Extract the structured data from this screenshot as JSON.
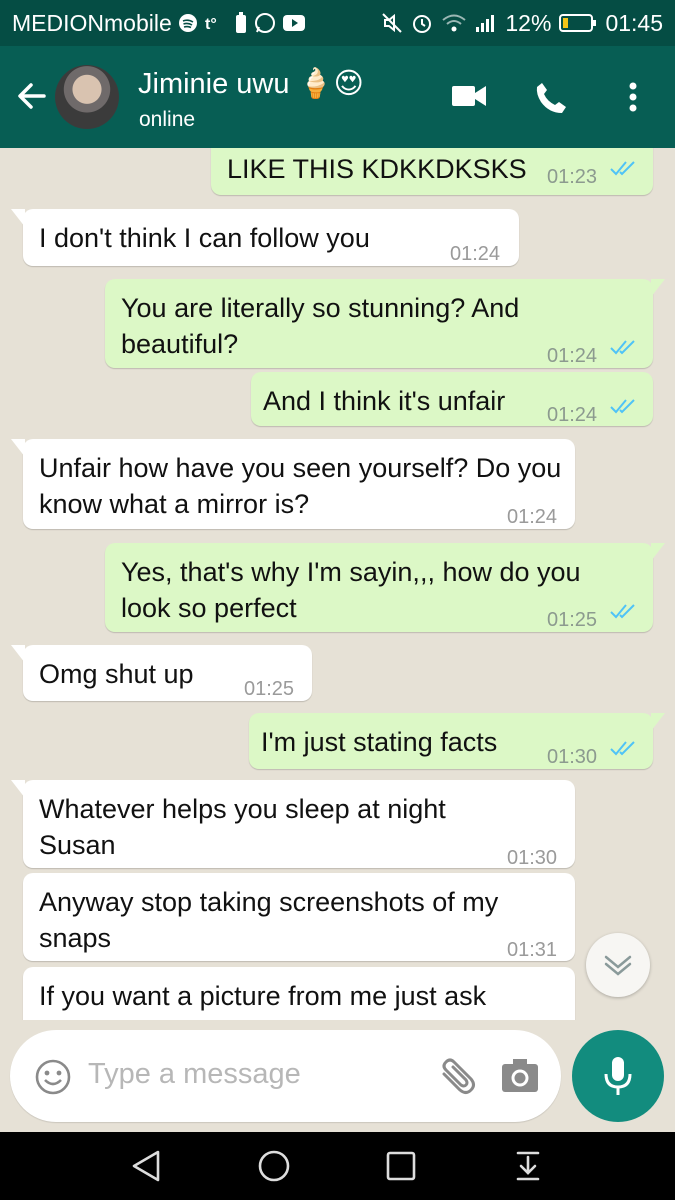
{
  "status_bar": {
    "carrier": "MEDIONmobile",
    "battery": "12%",
    "time": "01:45",
    "icons_left": [
      "spotify-icon",
      "t-mobile-icon",
      "battery-saver-icon",
      "whatsapp-icon",
      "youtube-icon"
    ],
    "icons_right": [
      "mute-icon",
      "alarm-icon",
      "wifi-icon",
      "signal-icon",
      "battery-icon"
    ]
  },
  "header": {
    "contact_name": "Jiminie uwu 🍦😍",
    "contact_status": "online",
    "color": "#075e54"
  },
  "messages": [
    {
      "dir": "out",
      "text": "LIKE THIS KDKKDKSKS",
      "time": "01:23",
      "read": true
    },
    {
      "dir": "in",
      "text": "I don't think I can follow you",
      "time": "01:24"
    },
    {
      "dir": "out",
      "text": "You are literally so stunning? And beautiful?",
      "time": "01:24",
      "read": true
    },
    {
      "dir": "out",
      "text": "And I think it's unfair",
      "time": "01:24",
      "read": true
    },
    {
      "dir": "in",
      "text": "Unfair how have you seen yourself? Do you know what a mirror is?",
      "time": "01:24"
    },
    {
      "dir": "out",
      "text": "Yes, that's why I'm sayin,,, how do you look so perfect",
      "time": "01:25",
      "read": true
    },
    {
      "dir": "in",
      "text": "Omg shut up",
      "time": "01:25"
    },
    {
      "dir": "out",
      "text": "I'm just stating facts",
      "time": "01:30",
      "read": true
    },
    {
      "dir": "in",
      "text": "Whatever helps you sleep at night Susan",
      "time": "01:30"
    },
    {
      "dir": "in",
      "text": "Anyway stop taking screenshots of my snaps",
      "time": "01:31"
    },
    {
      "dir": "in",
      "text": "If you want a picture from me just ask",
      "time": ""
    }
  ],
  "input": {
    "placeholder": "Type a message"
  },
  "colors": {
    "out_bubble": "#dcf8c6",
    "in_bubble": "#ffffff",
    "accent": "#128c7e",
    "read_tick": "#4fc3f7"
  }
}
